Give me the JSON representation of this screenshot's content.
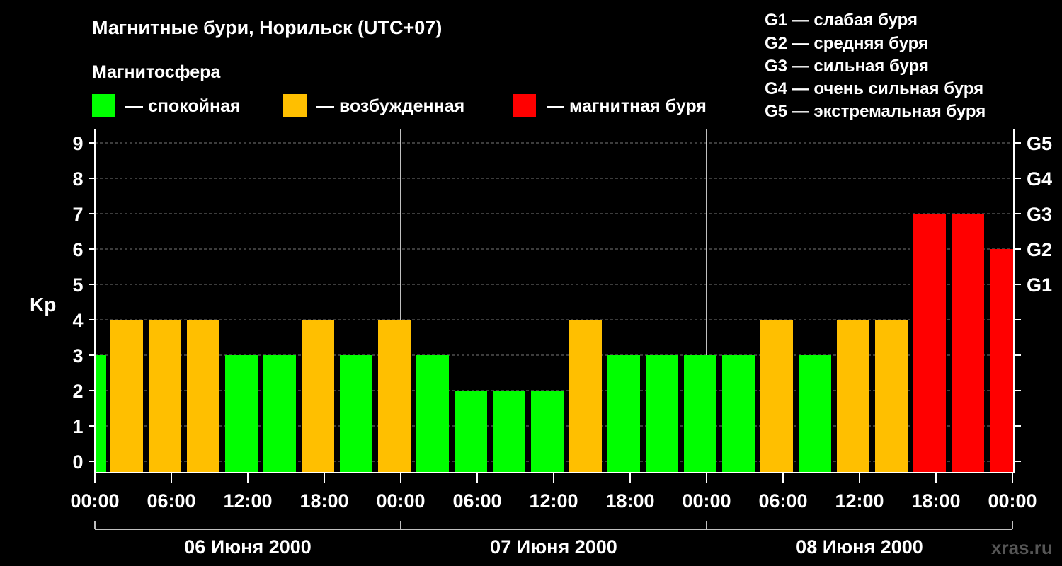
{
  "title": "Магнитные бури, Норильск (UTC+07)",
  "legend": {
    "heading": "Магнитосфера",
    "items": [
      {
        "label": "— спокойная",
        "color": "#00ff00"
      },
      {
        "label": "— возбужденная",
        "color": "#ffbf00"
      },
      {
        "label": "— магнитная буря",
        "color": "#ff0000"
      }
    ]
  },
  "g_scale": [
    "G1 — слабая буря",
    "G2 — средняя буря",
    "G3 — сильная буря",
    "G4 — очень сильная буря",
    "G5 — экстремальная буря"
  ],
  "watermark": "xras.ru",
  "colors": {
    "quiet": "#00ff00",
    "active": "#ffbf00",
    "storm": "#ff0000",
    "background": "#000000",
    "foreground": "#ffffff"
  },
  "chart_data": {
    "type": "bar",
    "ylabel": "Kp",
    "ylim": [
      0,
      9
    ],
    "yticks": [
      "0",
      "1",
      "2",
      "3",
      "4",
      "5",
      "6",
      "7",
      "8",
      "9"
    ],
    "right_axis_labels": [
      {
        "value": 5,
        "label": "G1"
      },
      {
        "value": 6,
        "label": "G2"
      },
      {
        "value": 7,
        "label": "G3"
      },
      {
        "value": 8,
        "label": "G4"
      },
      {
        "value": 9,
        "label": "G5"
      }
    ],
    "xticks": [
      "00:00",
      "06:00",
      "12:00",
      "18:00",
      "00:00",
      "06:00",
      "12:00",
      "18:00",
      "00:00",
      "06:00",
      "12:00",
      "18:00",
      "00:00"
    ],
    "days": [
      "06 Июня 2000",
      "07 Июня 2000",
      "08 Июня 2000"
    ],
    "categories": [
      "00:00",
      "03:00",
      "06:00",
      "09:00",
      "12:00",
      "15:00",
      "18:00",
      "21:00",
      "00:00",
      "03:00",
      "06:00",
      "09:00",
      "12:00",
      "15:00",
      "18:00",
      "21:00",
      "00:00",
      "03:00",
      "06:00",
      "09:00",
      "12:00",
      "15:00",
      "18:00",
      "21:00"
    ],
    "values": [
      4,
      4,
      4,
      3,
      3,
      4,
      3,
      4,
      3,
      2,
      2,
      2,
      4,
      3,
      3,
      3,
      3,
      4,
      3,
      4,
      4,
      7,
      7,
      6
    ],
    "first_hour_value": 3,
    "grid": "dashed horizontal"
  }
}
